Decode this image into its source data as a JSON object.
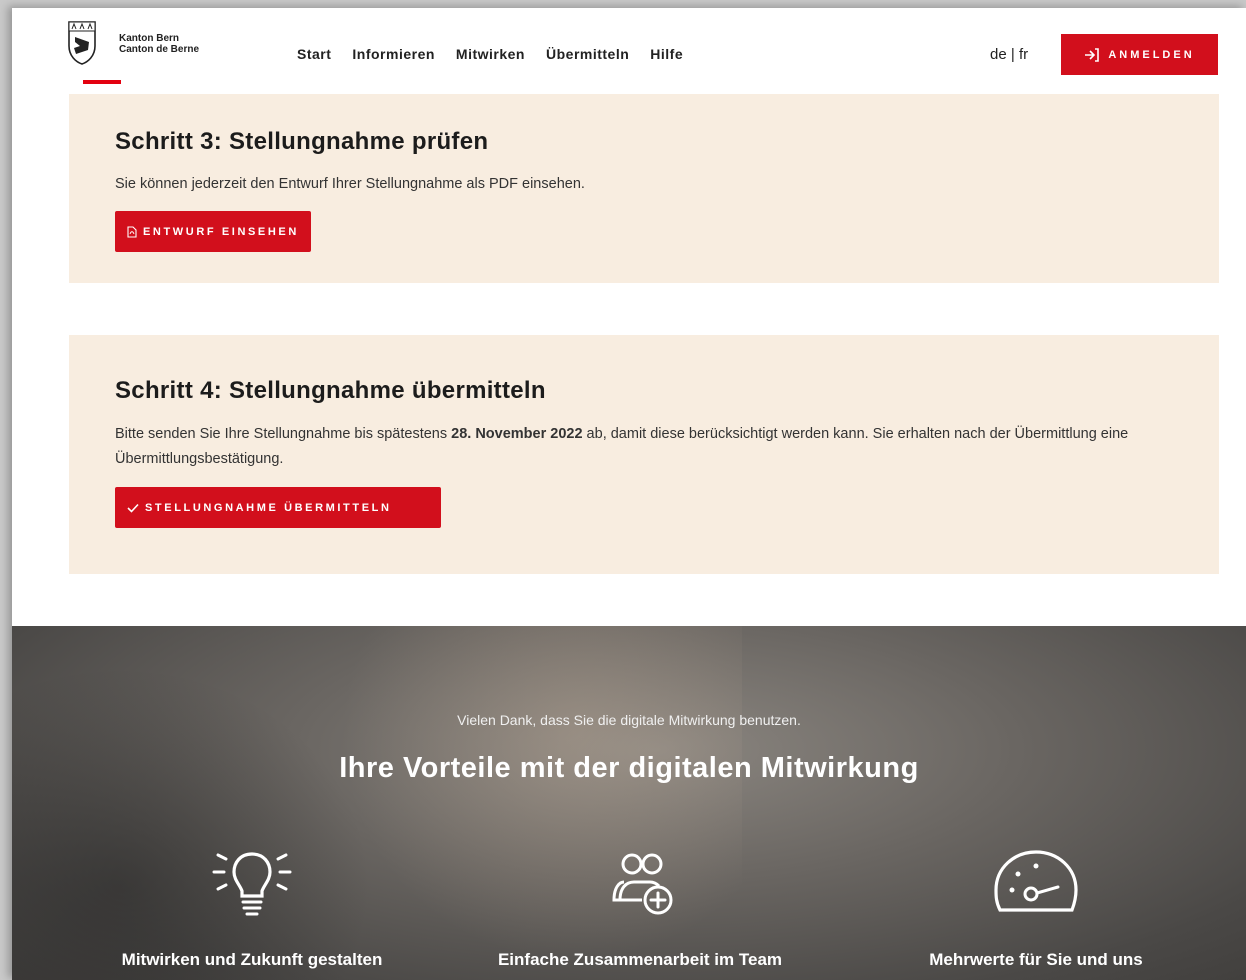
{
  "header": {
    "brand_line1": "Kanton Bern",
    "brand_line2": "Canton de Berne",
    "nav": [
      "Start",
      "Informieren",
      "Mitwirken",
      "Übermitteln",
      "Hilfe"
    ],
    "lang_de": "de",
    "lang_sep": "|",
    "lang_fr": "fr",
    "login_label": "ANMELDEN"
  },
  "step3": {
    "title": "Schritt 3: Stellungnahme prüfen",
    "text": "Sie können jederzeit den Entwurf Ihrer Stellungnahme als PDF einsehen.",
    "button": "ENTWURF EINSEHEN"
  },
  "step4": {
    "title": "Schritt 4: Stellungnahme übermitteln",
    "text_before": "Bitte senden Sie Ihre Stellungnahme bis spätestens ",
    "deadline": "28. November 2022",
    "text_after": " ab, damit diese berücksichtigt werden kann. Sie erhalten nach der Übermittlung eine Übermittlungsbestätigung.",
    "button": "STELLUNGNAHME ÜBERMITTELN"
  },
  "benefits": {
    "intro": "Vielen Dank, dass Sie die digitale Mitwirkung benutzen.",
    "title": "Ihre Vorteile mit der digitalen Mitwirkung",
    "items": [
      {
        "icon": "lightbulb-icon",
        "label": "Mitwirken und Zukunft gestalten"
      },
      {
        "icon": "team-add-icon",
        "label": "Einfache Zusammenarbeit im Team"
      },
      {
        "icon": "speedometer-icon",
        "label": "Mehrwerte für Sie und uns"
      }
    ]
  },
  "colors": {
    "accent": "#d20f1c",
    "step_bg": "#f8ede0",
    "dark_section": "#5e5a56"
  }
}
